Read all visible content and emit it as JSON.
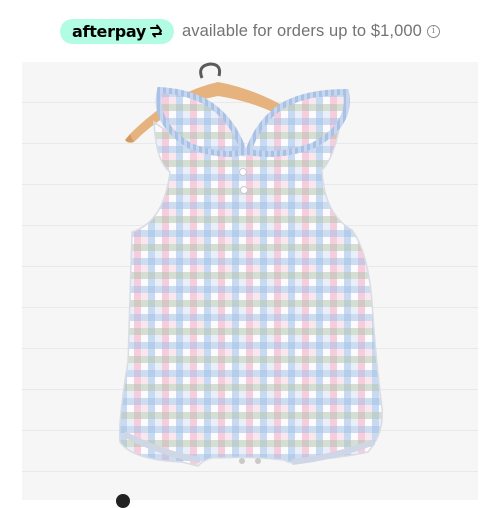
{
  "afterpay": {
    "logo_text": "afterpay",
    "logo_icon": "afterpay-arrows-icon",
    "message": "available for orders up to $1,000",
    "info_icon": "info-icon",
    "info_symbol": "i",
    "brand_color": "#b2fce4"
  },
  "product": {
    "image_icon": "gingham-bubble-romper-image",
    "colors": {
      "pink": "#f2a7c0",
      "blue": "#9fbfe6",
      "green": "#b6c7b0",
      "hanger": "#e6b27d"
    }
  }
}
